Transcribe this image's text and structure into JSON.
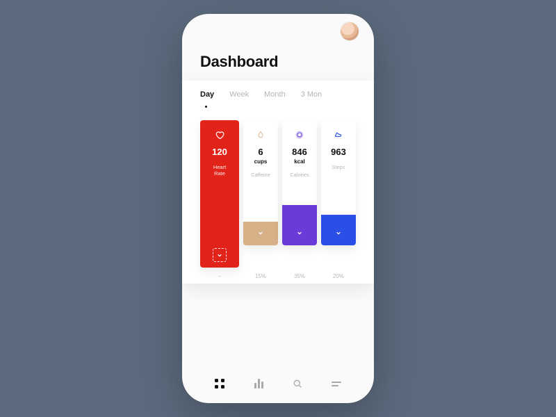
{
  "header": {
    "title": "Dashboard"
  },
  "tabs": [
    {
      "label": "Day",
      "active": true
    },
    {
      "label": "Week",
      "active": false
    },
    {
      "label": "Month",
      "active": false
    },
    {
      "label": "3 Mon",
      "active": false
    }
  ],
  "metrics": [
    {
      "icon": "heart-icon",
      "value": "120",
      "unit": "",
      "label": "Heart\nRate",
      "percent": "–",
      "color": "#e2231a",
      "fill_height": 0,
      "primary": true
    },
    {
      "icon": "drop-icon",
      "value": "6",
      "unit": "cups",
      "label": "Caffeine",
      "percent": "15%",
      "color": "#d8b088",
      "fill_height": 34
    },
    {
      "icon": "ring-icon",
      "value": "846",
      "unit": "kcal",
      "label": "Calories",
      "percent": "35%",
      "color": "#6b3bd9",
      "fill_height": 58
    },
    {
      "icon": "shoe-icon",
      "value": "963",
      "unit": "",
      "label": "Steps",
      "percent": "20%",
      "color": "#2b4ee6",
      "fill_height": 44
    }
  ],
  "nav": [
    "grid",
    "stats",
    "search",
    "menu"
  ]
}
